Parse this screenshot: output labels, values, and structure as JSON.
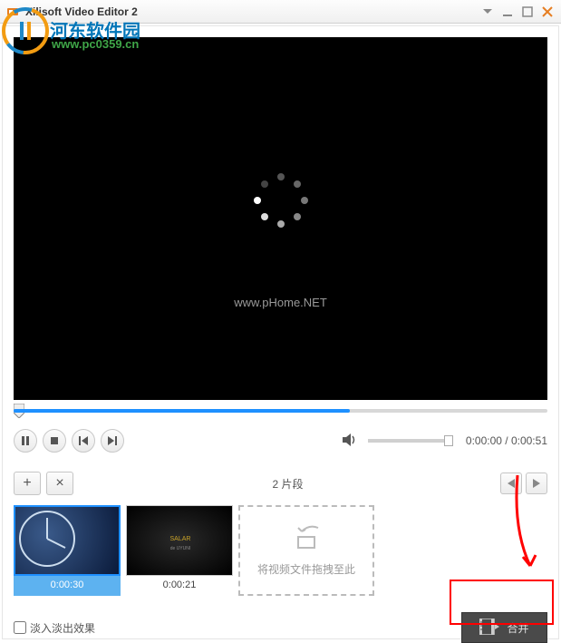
{
  "titlebar": {
    "title": "Xilisoft Video Editor 2"
  },
  "watermark": {
    "text1": "河东软件园",
    "text2": "www.pc0359.cn"
  },
  "video": {
    "overlay_url": "www.pHome.NET"
  },
  "playback": {
    "current": "0:00:00",
    "total": "0:00:51",
    "separator": " / "
  },
  "clips": {
    "count_label": "2 片段",
    "items": [
      {
        "duration": "0:00:30"
      },
      {
        "duration": "0:00:21"
      }
    ],
    "drop_hint": "将视频文件拖拽至此"
  },
  "options": {
    "fade_label": "淡入淡出效果"
  },
  "actions": {
    "merge_label": "合并"
  }
}
